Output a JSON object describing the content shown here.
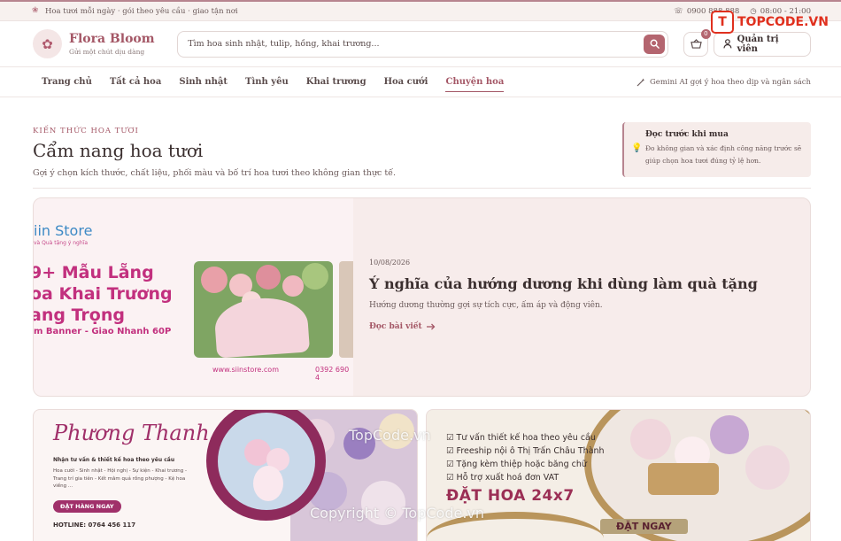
{
  "topbar": {
    "tagline": "Hoa tươi mỗi ngày · gói theo yêu cầu · giao tận nơi",
    "phone": "0900 888 888",
    "hours": "08:00 - 21:00"
  },
  "header": {
    "brand": "Flora Bloom",
    "slogan": "Gửi một chút dịu dàng",
    "search_placeholder": "Tìm hoa sinh nhật, tulip, hồng, khai trương...",
    "cart_count": "0",
    "admin_label": "Quản trị viên"
  },
  "nav": {
    "items": [
      "Trang chủ",
      "Tất cả hoa",
      "Sinh nhật",
      "Tình yêu",
      "Khai trương",
      "Hoa cưới",
      "Chuyện hoa"
    ],
    "active": "Chuyện hoa",
    "ai_hint": "Gemini AI gợi ý hoa theo dịp và ngân sách"
  },
  "section": {
    "eyebrow": "KIẾN THỨC HOA TƯƠI",
    "title": "Cẩm nang hoa tươi",
    "subtitle": "Gợi ý chọn kích thước, chất liệu, phối màu và bố trí hoa tươi theo không gian thực tế."
  },
  "tip": {
    "title": "Đọc trước khi mua",
    "text": "Đo không gian và xác định công năng trước sẽ giúp chọn hoa tươi đúng tỷ lệ hơn."
  },
  "featured": {
    "banner_brand": "iin Store",
    "banner_brand_sub": "và Quà tặng ý nghĩa",
    "banner_headline": [
      "9+ Mẫu Lẵng",
      "oa Khai Trương",
      "ang Trọng"
    ],
    "banner_promo": "m Banner - Giao Nhanh 60P",
    "banner_site": "www.siinstore.com",
    "banner_phone": "0392 690 4",
    "date": "10/08/2026",
    "title": "Ý nghĩa của hướng dương khi dùng làm quà tặng",
    "description": "Hướng dương thường gợi sự tích cực, ấm áp và động viên.",
    "read_more": "Đọc bài viết"
  },
  "cards": {
    "left": {
      "script_title": "Phương Thanh",
      "intro": "Nhận tư vấn & thiết kế hoa theo yêu cầu",
      "services": "Hoa cưới - Sinh nhật - Hội nghị - Sự kiện - Khai trương - Trang trí gia tiên - Kết mâm quả rồng phượng - Kệ hoa viếng ...",
      "cta": "ĐẶT HÀNG NGAY",
      "hotline": "HOTLINE: 0764 456 117"
    },
    "right": {
      "features": [
        "Tư vấn thiết kế hoa theo yêu cầu",
        "Freeship nội ô Thị Trấn Châu Thành",
        "Tặng kèm thiệp hoặc băng chữ",
        "Hỗ trợ xuất hoá đơn VAT"
      ],
      "headline": "ĐẶT HOA 24x7",
      "cta": "ĐẶT NGAY"
    }
  },
  "watermark": {
    "top": "TopCode.vn",
    "bottom": "Copyright © TopCode.vn",
    "logo_text": "TOPCODE.VN",
    "logo_mark": "T"
  },
  "colors": {
    "accent": "#a45766",
    "button": "#b4656f",
    "soft_bg": "#f7eceb"
  }
}
